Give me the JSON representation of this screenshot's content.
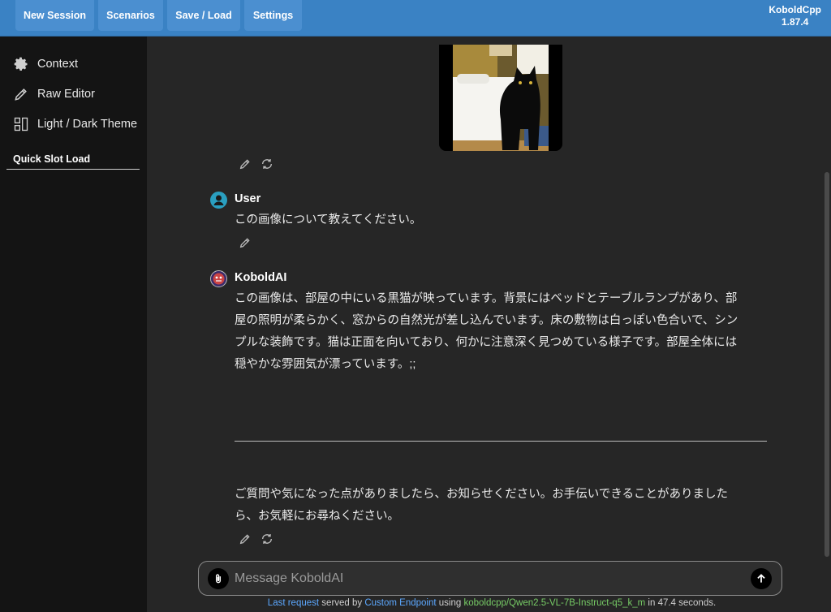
{
  "header": {
    "nav": [
      "New Session",
      "Scenarios",
      "Save / Load",
      "Settings"
    ],
    "brand_name": "KoboldCpp",
    "brand_version": "1.87.4"
  },
  "sidebar": {
    "items": [
      {
        "label": "Context",
        "icon": "gear-icon"
      },
      {
        "label": "Raw Editor",
        "icon": "pencil-icon"
      },
      {
        "label": "Light / Dark Theme",
        "icon": "layout-icon"
      }
    ],
    "quick_slot_label": "Quick Slot Load"
  },
  "chat": {
    "user_name": "User",
    "user_message": "この画像について教えてください。",
    "ai_name": "KoboldAI",
    "ai_lines": [
      "この画像は、部屋の中にいる黒猫が映っています。背景にはベッドとテーブルランプがあり、部",
      "屋の照明が柔らかく、窓からの自然光が差し込んでいます。床の敷物は白っぽい色合いで、シン",
      "プルな装飾です。猫は正面を向いており、何かに注意深く見つめている様子です。部屋全体には",
      "穏やかな雰囲気が漂っています。;;"
    ],
    "ai_followup_lines": [
      "ご質問や気になった点がありましたら、お知らせください。お手伝いできることがありました",
      "ら、お気軽にお尋ねください。"
    ]
  },
  "input": {
    "placeholder": "Message KoboldAI"
  },
  "footer": {
    "last_request": "Last request",
    "served_by": "served by",
    "endpoint": "Custom Endpoint",
    "using": "using",
    "model": "koboldcpp/Qwen2.5-VL-7B-Instruct-q5_k_m",
    "timing": "in 47.4 seconds."
  },
  "colors": {
    "accent": "#3a82c4",
    "link": "#5ca8ff",
    "model": "#77cc66"
  }
}
